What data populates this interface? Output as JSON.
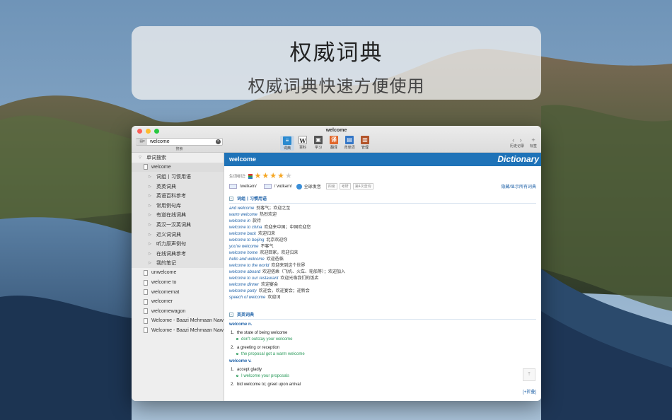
{
  "banner": {
    "title": "权威词典",
    "subtitle": "权威词典快速方便使用"
  },
  "window": {
    "title": "welcome"
  },
  "search": {
    "value": "welcome",
    "label": "搜索"
  },
  "toolbar": [
    {
      "label": "词典",
      "icon": "dictionary-icon",
      "active": true
    },
    {
      "label": "百科",
      "icon": "wikipedia-icon",
      "active": false
    },
    {
      "label": "学习",
      "icon": "study-icon",
      "active": false
    },
    {
      "label": "翻译",
      "icon": "translate-icon",
      "active": false
    },
    {
      "label": "背单词",
      "icon": "vocabulary-icon",
      "active": false
    },
    {
      "label": "管理",
      "icon": "manage-icon",
      "active": false
    }
  ],
  "nav": {
    "history_label": "历史记录",
    "bookmark_label": "标签"
  },
  "sidebar": {
    "group_label": "单词搜索",
    "current": "welcome",
    "sub_items": [
      "词组丨习惯用语",
      "英英词典",
      "英语百科参考",
      "常用例句库",
      "有道在线词典",
      "英汉一汉英词典",
      "近义词词典",
      "听力原声例句",
      "在线词典参考",
      "我的笔记"
    ],
    "related": [
      "unwelcome",
      "welcome to",
      "welcomemat",
      "welcomer",
      "welcomewagon",
      "Welcome - Baazi Mehmaan Naw...",
      "Welcome - Baazi Mehmaan Naw..."
    ]
  },
  "entry": {
    "word": "welcome",
    "brand": "Dictionary",
    "rating_label": "生词标记:",
    "rating": 4,
    "rating_max": 5,
    "uk_pron": "/welkəm/",
    "us_pron": "/ˈwɛlkəm/",
    "global_pron": "全球发音",
    "badges": [
      "四级",
      "考研",
      "第4次查询"
    ],
    "toggle_all": "隐藏/显示所有词典",
    "phrases_title": "词组丨习惯用语",
    "phrases": [
      {
        "en": "and welcome",
        "zh": "别客气；欢迎之至"
      },
      {
        "en": "warm welcome",
        "zh": "热烈欢迎"
      },
      {
        "en": "welcome in",
        "zh": "款待"
      },
      {
        "en": "welcome to china",
        "zh": "欢迎来中国；中国欢迎您"
      },
      {
        "en": "welcome back",
        "zh": "欢迎归来"
      },
      {
        "en": "welcome to beijing",
        "zh": "北京欢迎你"
      },
      {
        "en": "you're welcome",
        "zh": "不客气"
      },
      {
        "en": "welcome home",
        "zh": "欢迎回家，欢迎归来"
      },
      {
        "en": "hello and welcome",
        "zh": "欢迎莅临"
      },
      {
        "en": "welcome to the world",
        "zh": "欢迎来到这个世界"
      },
      {
        "en": "welcome aboard",
        "zh": "欢迎搭乘（飞机、火车、轮船等）；欢迎加入"
      },
      {
        "en": "welcome to our restaurant",
        "zh": "欢迎光临我们的饭店"
      },
      {
        "en": "welcome dinner",
        "zh": "欢迎宴会"
      },
      {
        "en": "welcome party",
        "zh": "欢迎会，欢迎宴会；迎新会"
      },
      {
        "en": "speech of welcome",
        "zh": "欢迎词"
      }
    ],
    "ee_title": "英英词典",
    "senses": [
      {
        "pos": "welcome n.",
        "defs": [
          {
            "num": "1.",
            "text": "the state of being welcome",
            "example": "don't outstay your welcome"
          },
          {
            "num": "2.",
            "text": "a greeting or reception",
            "example": "the proposal got a warm welcome"
          }
        ]
      },
      {
        "pos": "welcome v.",
        "defs": [
          {
            "num": "1.",
            "text": "accept gladly",
            "example": "I welcome your proposals"
          },
          {
            "num": "2.",
            "text": "bid welcome to; greet upon arrival",
            "example": ""
          }
        ]
      }
    ],
    "expand_link": "[+折叠]"
  }
}
